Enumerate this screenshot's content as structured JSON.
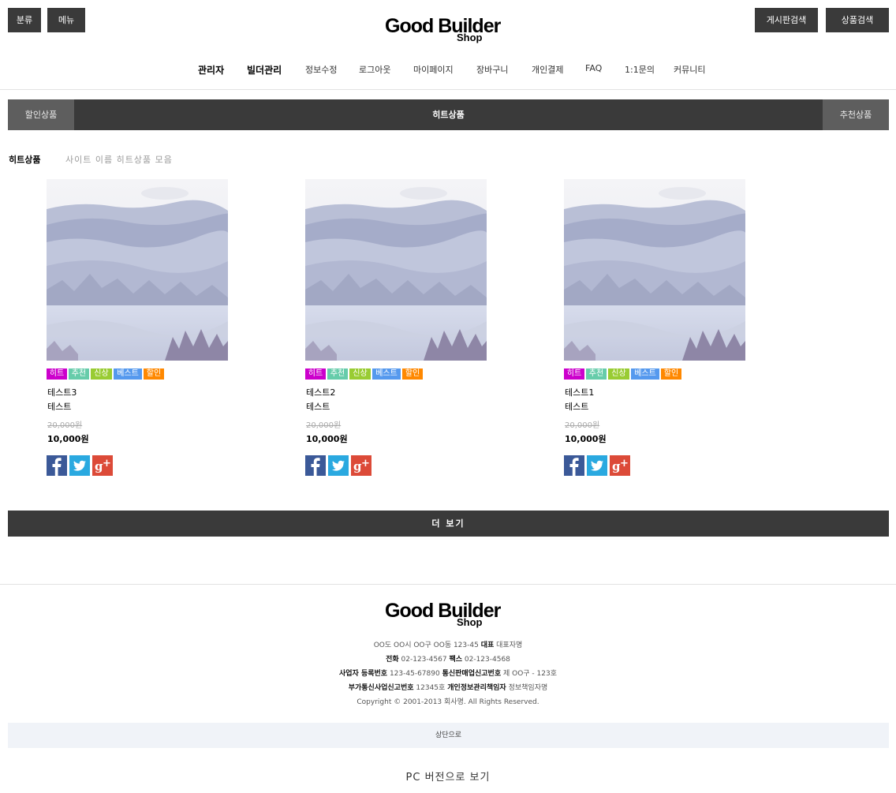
{
  "header": {
    "category_button": "분류",
    "menu_button": "메뉴",
    "logo_main": "Good Builder",
    "logo_sub": "Shop",
    "board_search_button": "게시판검색",
    "product_search_button": "상품검색"
  },
  "nav": {
    "items": [
      {
        "label": "관리자"
      },
      {
        "label": "빌더관리"
      },
      {
        "label": "정보수정"
      },
      {
        "label": "로그아웃"
      },
      {
        "label": "마이페이지"
      },
      {
        "label": "장바구니"
      },
      {
        "label": "개인결제"
      },
      {
        "label": "FAQ"
      },
      {
        "label": "1:1문의"
      },
      {
        "label": "커뮤니티"
      }
    ]
  },
  "tabs": {
    "left": "할인상품",
    "center": "히트상품",
    "right": "추천상품"
  },
  "section": {
    "title": "히트상품",
    "subtitle": "사이트 이름 히트상품 모음"
  },
  "badge_colors": {
    "hit": "#cc00cc",
    "recommend": "#66ccaa",
    "new": "#99cc33",
    "best": "#5599ee",
    "sale": "#ff8800"
  },
  "products": [
    {
      "badges": [
        "히트",
        "추천",
        "신상",
        "베스트",
        "할인"
      ],
      "name": "테스트3",
      "desc": "테스트",
      "original_price": "20,000원",
      "price": "10,000원"
    },
    {
      "badges": [
        "히트",
        "추천",
        "신상",
        "베스트",
        "할인"
      ],
      "name": "테스트2",
      "desc": "테스트",
      "original_price": "20,000원",
      "price": "10,000원"
    },
    {
      "badges": [
        "히트",
        "추천",
        "신상",
        "베스트",
        "할인"
      ],
      "name": "테스트1",
      "desc": "테스트",
      "original_price": "20,000원",
      "price": "10,000원"
    }
  ],
  "more_button": "더 보기",
  "footer": {
    "logo_main": "Good Builder",
    "logo_sub": "Shop",
    "address": "OO도 OO시 OO구 OO동 123-45",
    "rep_label": "대표",
    "rep_value": "대표자명",
    "tel_label": "전화",
    "tel_value": "02-123-4567",
    "fax_label": "팩스",
    "fax_value": "02-123-4568",
    "biz_label": "사업자 등록번호",
    "biz_value": "123-45-67890",
    "mail_order_label": "통신판매업신고번호",
    "mail_order_value": "제 OO구 - 123호",
    "vas_label": "부가통신사업신고번호",
    "vas_value": "12345호",
    "privacy_label": "개인정보관리책임자",
    "privacy_value": "정보책임자명",
    "copyright": "Copyright © 2001-2013 회사명. All Rights Reserved.",
    "to_top": "상단으로",
    "pc_version": "PC 버전으로 보기"
  }
}
